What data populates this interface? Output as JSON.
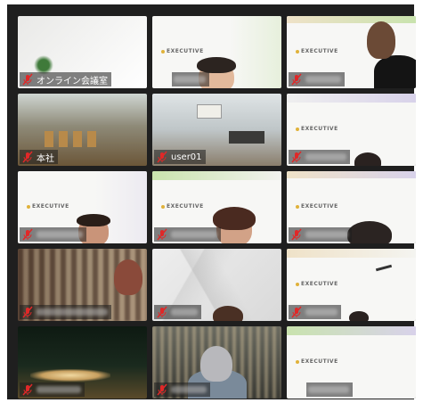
{
  "slide_logo": "EXECUTIVE",
  "tiles": [
    {
      "name": "オンライン会議室",
      "muted": true
    },
    {
      "name": "",
      "muted": false
    },
    {
      "name": "",
      "muted": true
    },
    {
      "name": "",
      "muted": false
    },
    {
      "name": "本社",
      "muted": true
    },
    {
      "name": "user01",
      "muted": true
    },
    {
      "name": "",
      "muted": false
    },
    {
      "name": "",
      "muted": true
    },
    {
      "name": "",
      "muted": true
    },
    {
      "name": "",
      "muted": true
    },
    {
      "name": "",
      "muted": true
    },
    {
      "name": "",
      "muted": true
    },
    {
      "name": "",
      "muted": true
    },
    {
      "name": "",
      "muted": true
    },
    {
      "name": "",
      "muted": true
    },
    {
      "name": "",
      "muted": true
    },
    {
      "name": "",
      "muted": false
    },
    {
      "name": "",
      "muted": true
    },
    {
      "name": "",
      "muted": true
    },
    {
      "name": "",
      "muted": true
    },
    {
      "name": "",
      "muted": false
    }
  ],
  "colors": {
    "gallery_bg": "#1f1f1f",
    "mute_red": "#e02828",
    "slide_green": "#8fc25a",
    "slide_purple": "#7d6fb0"
  }
}
